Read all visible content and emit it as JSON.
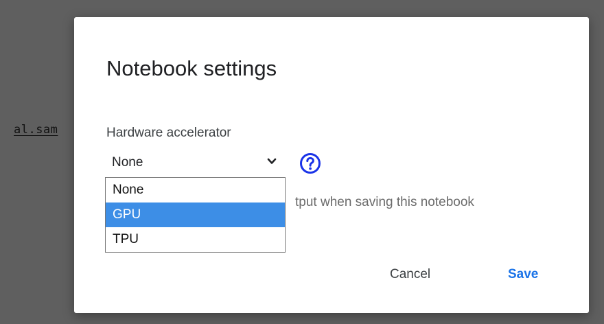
{
  "background": {
    "code_fragment": "al.sam"
  },
  "dialog": {
    "title": "Notebook settings",
    "hardware_label": "Hardware accelerator",
    "select_value": "None",
    "options": [
      "None",
      "GPU",
      "TPU"
    ],
    "highlighted_option": "GPU",
    "checkbox_text_visible": "tput when saving this notebook",
    "cancel_label": "Cancel",
    "save_label": "Save"
  },
  "colors": {
    "accent": "#1a73e8",
    "help_icon": "#1a33e8",
    "highlight": "#3d8ee6"
  },
  "icons": {
    "select_chevron": "chevron-down-icon",
    "help": "help-circle-icon"
  }
}
